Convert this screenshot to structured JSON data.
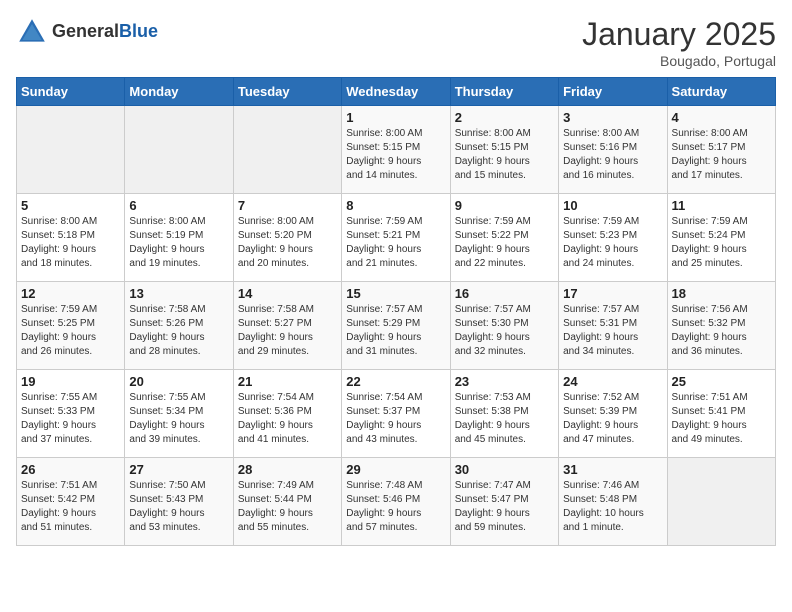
{
  "header": {
    "logo_general": "General",
    "logo_blue": "Blue",
    "month": "January 2025",
    "location": "Bougado, Portugal"
  },
  "days_of_week": [
    "Sunday",
    "Monday",
    "Tuesday",
    "Wednesday",
    "Thursday",
    "Friday",
    "Saturday"
  ],
  "weeks": [
    [
      {
        "day": "",
        "info": ""
      },
      {
        "day": "",
        "info": ""
      },
      {
        "day": "",
        "info": ""
      },
      {
        "day": "1",
        "info": "Sunrise: 8:00 AM\nSunset: 5:15 PM\nDaylight: 9 hours\nand 14 minutes."
      },
      {
        "day": "2",
        "info": "Sunrise: 8:00 AM\nSunset: 5:15 PM\nDaylight: 9 hours\nand 15 minutes."
      },
      {
        "day": "3",
        "info": "Sunrise: 8:00 AM\nSunset: 5:16 PM\nDaylight: 9 hours\nand 16 minutes."
      },
      {
        "day": "4",
        "info": "Sunrise: 8:00 AM\nSunset: 5:17 PM\nDaylight: 9 hours\nand 17 minutes."
      }
    ],
    [
      {
        "day": "5",
        "info": "Sunrise: 8:00 AM\nSunset: 5:18 PM\nDaylight: 9 hours\nand 18 minutes."
      },
      {
        "day": "6",
        "info": "Sunrise: 8:00 AM\nSunset: 5:19 PM\nDaylight: 9 hours\nand 19 minutes."
      },
      {
        "day": "7",
        "info": "Sunrise: 8:00 AM\nSunset: 5:20 PM\nDaylight: 9 hours\nand 20 minutes."
      },
      {
        "day": "8",
        "info": "Sunrise: 7:59 AM\nSunset: 5:21 PM\nDaylight: 9 hours\nand 21 minutes."
      },
      {
        "day": "9",
        "info": "Sunrise: 7:59 AM\nSunset: 5:22 PM\nDaylight: 9 hours\nand 22 minutes."
      },
      {
        "day": "10",
        "info": "Sunrise: 7:59 AM\nSunset: 5:23 PM\nDaylight: 9 hours\nand 24 minutes."
      },
      {
        "day": "11",
        "info": "Sunrise: 7:59 AM\nSunset: 5:24 PM\nDaylight: 9 hours\nand 25 minutes."
      }
    ],
    [
      {
        "day": "12",
        "info": "Sunrise: 7:59 AM\nSunset: 5:25 PM\nDaylight: 9 hours\nand 26 minutes."
      },
      {
        "day": "13",
        "info": "Sunrise: 7:58 AM\nSunset: 5:26 PM\nDaylight: 9 hours\nand 28 minutes."
      },
      {
        "day": "14",
        "info": "Sunrise: 7:58 AM\nSunset: 5:27 PM\nDaylight: 9 hours\nand 29 minutes."
      },
      {
        "day": "15",
        "info": "Sunrise: 7:57 AM\nSunset: 5:29 PM\nDaylight: 9 hours\nand 31 minutes."
      },
      {
        "day": "16",
        "info": "Sunrise: 7:57 AM\nSunset: 5:30 PM\nDaylight: 9 hours\nand 32 minutes."
      },
      {
        "day": "17",
        "info": "Sunrise: 7:57 AM\nSunset: 5:31 PM\nDaylight: 9 hours\nand 34 minutes."
      },
      {
        "day": "18",
        "info": "Sunrise: 7:56 AM\nSunset: 5:32 PM\nDaylight: 9 hours\nand 36 minutes."
      }
    ],
    [
      {
        "day": "19",
        "info": "Sunrise: 7:55 AM\nSunset: 5:33 PM\nDaylight: 9 hours\nand 37 minutes."
      },
      {
        "day": "20",
        "info": "Sunrise: 7:55 AM\nSunset: 5:34 PM\nDaylight: 9 hours\nand 39 minutes."
      },
      {
        "day": "21",
        "info": "Sunrise: 7:54 AM\nSunset: 5:36 PM\nDaylight: 9 hours\nand 41 minutes."
      },
      {
        "day": "22",
        "info": "Sunrise: 7:54 AM\nSunset: 5:37 PM\nDaylight: 9 hours\nand 43 minutes."
      },
      {
        "day": "23",
        "info": "Sunrise: 7:53 AM\nSunset: 5:38 PM\nDaylight: 9 hours\nand 45 minutes."
      },
      {
        "day": "24",
        "info": "Sunrise: 7:52 AM\nSunset: 5:39 PM\nDaylight: 9 hours\nand 47 minutes."
      },
      {
        "day": "25",
        "info": "Sunrise: 7:51 AM\nSunset: 5:41 PM\nDaylight: 9 hours\nand 49 minutes."
      }
    ],
    [
      {
        "day": "26",
        "info": "Sunrise: 7:51 AM\nSunset: 5:42 PM\nDaylight: 9 hours\nand 51 minutes."
      },
      {
        "day": "27",
        "info": "Sunrise: 7:50 AM\nSunset: 5:43 PM\nDaylight: 9 hours\nand 53 minutes."
      },
      {
        "day": "28",
        "info": "Sunrise: 7:49 AM\nSunset: 5:44 PM\nDaylight: 9 hours\nand 55 minutes."
      },
      {
        "day": "29",
        "info": "Sunrise: 7:48 AM\nSunset: 5:46 PM\nDaylight: 9 hours\nand 57 minutes."
      },
      {
        "day": "30",
        "info": "Sunrise: 7:47 AM\nSunset: 5:47 PM\nDaylight: 9 hours\nand 59 minutes."
      },
      {
        "day": "31",
        "info": "Sunrise: 7:46 AM\nSunset: 5:48 PM\nDaylight: 10 hours\nand 1 minute."
      },
      {
        "day": "",
        "info": ""
      }
    ]
  ]
}
